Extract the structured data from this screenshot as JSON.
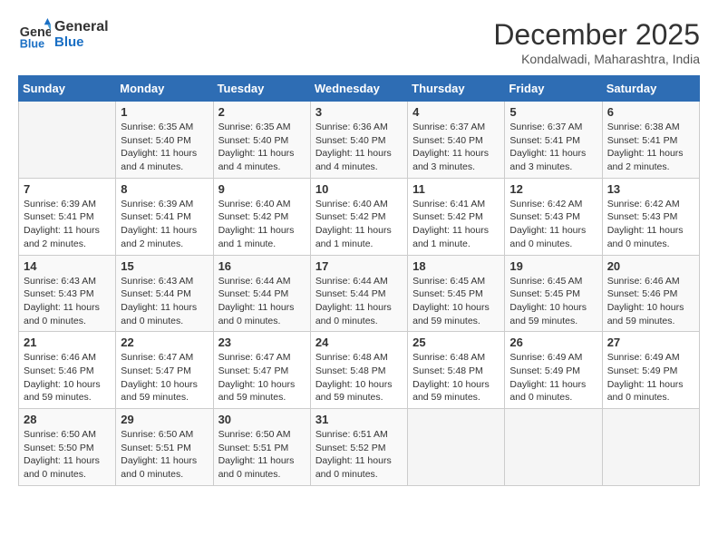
{
  "header": {
    "logo_line1": "General",
    "logo_line2": "Blue",
    "month": "December 2025",
    "location": "Kondalwadi, Maharashtra, India"
  },
  "days_of_week": [
    "Sunday",
    "Monday",
    "Tuesday",
    "Wednesday",
    "Thursday",
    "Friday",
    "Saturday"
  ],
  "weeks": [
    [
      {
        "day": "",
        "info": ""
      },
      {
        "day": "1",
        "info": "Sunrise: 6:35 AM\nSunset: 5:40 PM\nDaylight: 11 hours\nand 4 minutes."
      },
      {
        "day": "2",
        "info": "Sunrise: 6:35 AM\nSunset: 5:40 PM\nDaylight: 11 hours\nand 4 minutes."
      },
      {
        "day": "3",
        "info": "Sunrise: 6:36 AM\nSunset: 5:40 PM\nDaylight: 11 hours\nand 4 minutes."
      },
      {
        "day": "4",
        "info": "Sunrise: 6:37 AM\nSunset: 5:40 PM\nDaylight: 11 hours\nand 3 minutes."
      },
      {
        "day": "5",
        "info": "Sunrise: 6:37 AM\nSunset: 5:41 PM\nDaylight: 11 hours\nand 3 minutes."
      },
      {
        "day": "6",
        "info": "Sunrise: 6:38 AM\nSunset: 5:41 PM\nDaylight: 11 hours\nand 2 minutes."
      }
    ],
    [
      {
        "day": "7",
        "info": "Sunrise: 6:39 AM\nSunset: 5:41 PM\nDaylight: 11 hours\nand 2 minutes."
      },
      {
        "day": "8",
        "info": "Sunrise: 6:39 AM\nSunset: 5:41 PM\nDaylight: 11 hours\nand 2 minutes."
      },
      {
        "day": "9",
        "info": "Sunrise: 6:40 AM\nSunset: 5:42 PM\nDaylight: 11 hours\nand 1 minute."
      },
      {
        "day": "10",
        "info": "Sunrise: 6:40 AM\nSunset: 5:42 PM\nDaylight: 11 hours\nand 1 minute."
      },
      {
        "day": "11",
        "info": "Sunrise: 6:41 AM\nSunset: 5:42 PM\nDaylight: 11 hours\nand 1 minute."
      },
      {
        "day": "12",
        "info": "Sunrise: 6:42 AM\nSunset: 5:43 PM\nDaylight: 11 hours\nand 0 minutes."
      },
      {
        "day": "13",
        "info": "Sunrise: 6:42 AM\nSunset: 5:43 PM\nDaylight: 11 hours\nand 0 minutes."
      }
    ],
    [
      {
        "day": "14",
        "info": "Sunrise: 6:43 AM\nSunset: 5:43 PM\nDaylight: 11 hours\nand 0 minutes."
      },
      {
        "day": "15",
        "info": "Sunrise: 6:43 AM\nSunset: 5:44 PM\nDaylight: 11 hours\nand 0 minutes."
      },
      {
        "day": "16",
        "info": "Sunrise: 6:44 AM\nSunset: 5:44 PM\nDaylight: 11 hours\nand 0 minutes."
      },
      {
        "day": "17",
        "info": "Sunrise: 6:44 AM\nSunset: 5:44 PM\nDaylight: 11 hours\nand 0 minutes."
      },
      {
        "day": "18",
        "info": "Sunrise: 6:45 AM\nSunset: 5:45 PM\nDaylight: 10 hours\nand 59 minutes."
      },
      {
        "day": "19",
        "info": "Sunrise: 6:45 AM\nSunset: 5:45 PM\nDaylight: 10 hours\nand 59 minutes."
      },
      {
        "day": "20",
        "info": "Sunrise: 6:46 AM\nSunset: 5:46 PM\nDaylight: 10 hours\nand 59 minutes."
      }
    ],
    [
      {
        "day": "21",
        "info": "Sunrise: 6:46 AM\nSunset: 5:46 PM\nDaylight: 10 hours\nand 59 minutes."
      },
      {
        "day": "22",
        "info": "Sunrise: 6:47 AM\nSunset: 5:47 PM\nDaylight: 10 hours\nand 59 minutes."
      },
      {
        "day": "23",
        "info": "Sunrise: 6:47 AM\nSunset: 5:47 PM\nDaylight: 10 hours\nand 59 minutes."
      },
      {
        "day": "24",
        "info": "Sunrise: 6:48 AM\nSunset: 5:48 PM\nDaylight: 10 hours\nand 59 minutes."
      },
      {
        "day": "25",
        "info": "Sunrise: 6:48 AM\nSunset: 5:48 PM\nDaylight: 10 hours\nand 59 minutes."
      },
      {
        "day": "26",
        "info": "Sunrise: 6:49 AM\nSunset: 5:49 PM\nDaylight: 11 hours\nand 0 minutes."
      },
      {
        "day": "27",
        "info": "Sunrise: 6:49 AM\nSunset: 5:49 PM\nDaylight: 11 hours\nand 0 minutes."
      }
    ],
    [
      {
        "day": "28",
        "info": "Sunrise: 6:50 AM\nSunset: 5:50 PM\nDaylight: 11 hours\nand 0 minutes."
      },
      {
        "day": "29",
        "info": "Sunrise: 6:50 AM\nSunset: 5:51 PM\nDaylight: 11 hours\nand 0 minutes."
      },
      {
        "day": "30",
        "info": "Sunrise: 6:50 AM\nSunset: 5:51 PM\nDaylight: 11 hours\nand 0 minutes."
      },
      {
        "day": "31",
        "info": "Sunrise: 6:51 AM\nSunset: 5:52 PM\nDaylight: 11 hours\nand 0 minutes."
      },
      {
        "day": "",
        "info": ""
      },
      {
        "day": "",
        "info": ""
      },
      {
        "day": "",
        "info": ""
      }
    ]
  ]
}
